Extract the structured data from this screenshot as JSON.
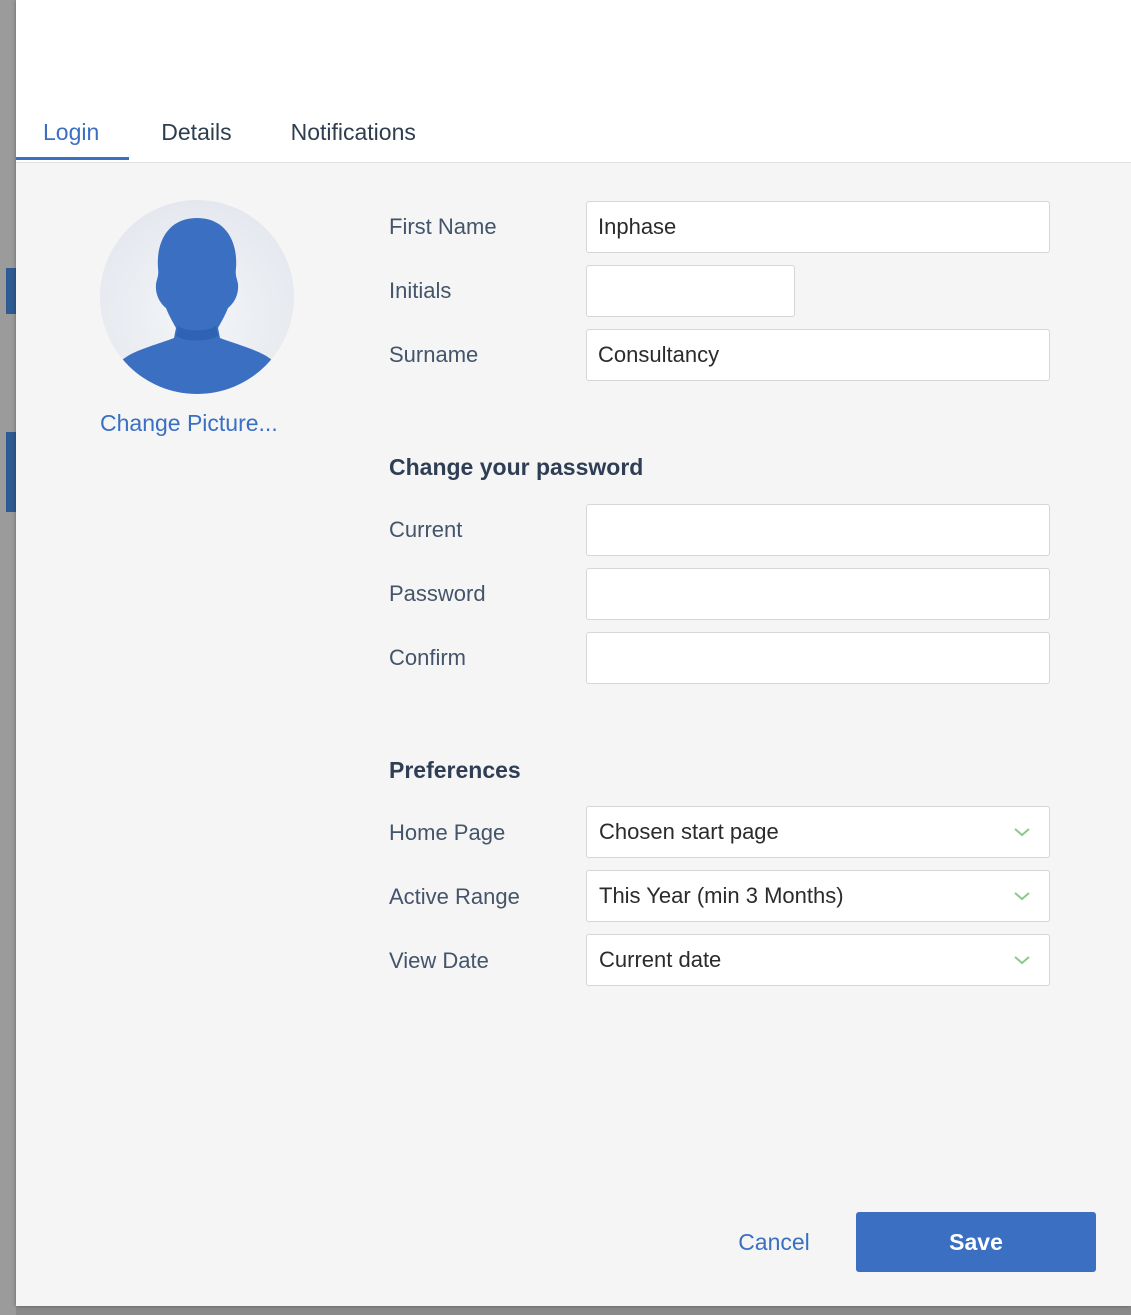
{
  "tabs": [
    {
      "label": "Login",
      "active": true
    },
    {
      "label": "Details",
      "active": false
    },
    {
      "label": "Notifications",
      "active": false
    }
  ],
  "avatar": {
    "icon": "user-silhouette-icon",
    "change_label": "Change Picture..."
  },
  "name_fields": {
    "first_name": {
      "label": "First Name",
      "value": "Inphase"
    },
    "initials": {
      "label": "Initials",
      "value": ""
    },
    "surname": {
      "label": "Surname",
      "value": "Consultancy"
    }
  },
  "password_section": {
    "title": "Change your password",
    "current": {
      "label": "Current",
      "value": ""
    },
    "password": {
      "label": "Password",
      "value": ""
    },
    "confirm": {
      "label": "Confirm",
      "value": ""
    }
  },
  "preferences_section": {
    "title": "Preferences",
    "home_page": {
      "label": "Home Page",
      "value": "Chosen start page"
    },
    "active_range": {
      "label": "Active Range",
      "value": "This Year (min 3 Months)"
    },
    "view_date": {
      "label": "View Date",
      "value": "Current date"
    }
  },
  "actions": {
    "cancel_label": "Cancel",
    "save_label": "Save"
  },
  "colors": {
    "accent": "#3a6fc2",
    "chevron": "#8cc98c",
    "avatar_figure": "#3a6fc2"
  }
}
